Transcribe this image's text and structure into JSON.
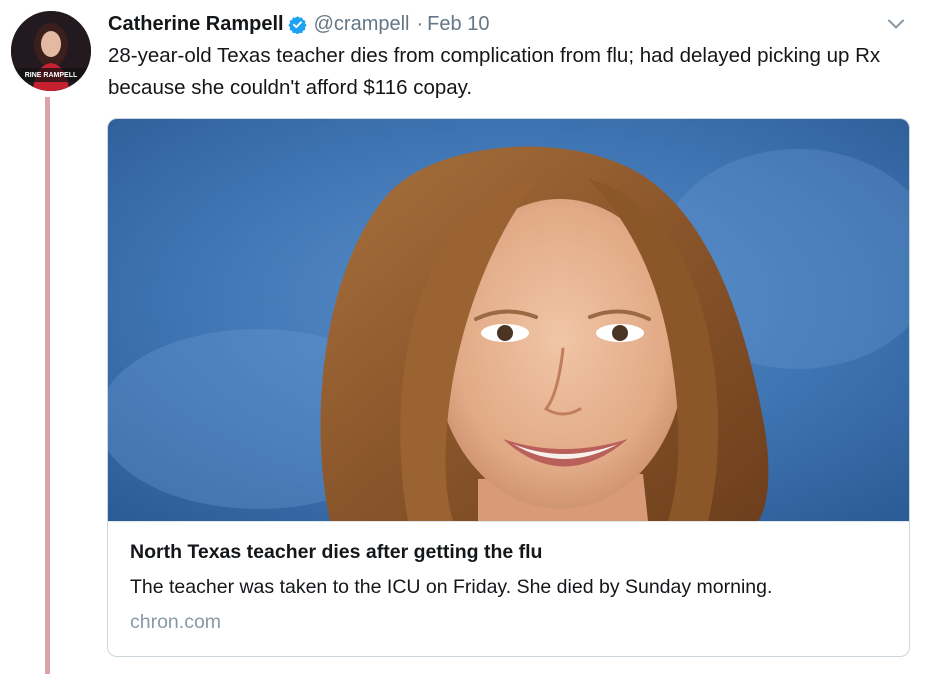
{
  "tweet": {
    "author_name": "Catherine Rampell",
    "handle": "@crampell",
    "separator": "·",
    "date": "Feb 10",
    "text": "28-year-old Texas teacher dies from complication from flu; had delayed picking up Rx because she couldn't afford $116 copay.",
    "avatar_caption": "RINE RAMPELL",
    "icons": {
      "verified": "verified-badge-icon",
      "menu": "chevron-down-icon"
    }
  },
  "card": {
    "title": "North Texas teacher dies after getting the flu",
    "description": "The teacher was taken to the ICU on Friday. She died by Sunday morning.",
    "domain": "chron.com"
  },
  "colors": {
    "verified_blue": "#1da1f2",
    "secondary_text": "#657786",
    "domain_text": "#8899a6",
    "thread_line": "#d9a3a9",
    "card_border": "#ccd6dd",
    "photo_background": "#3f74b3"
  }
}
